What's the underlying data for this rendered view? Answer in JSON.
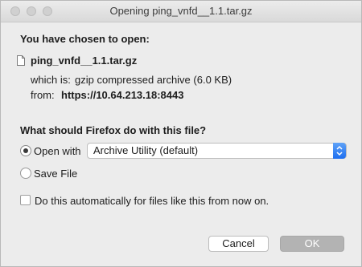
{
  "window": {
    "title": "Opening ping_vnfd__1.1.tar.gz"
  },
  "open": {
    "heading": "You have chosen to open:",
    "filename": "ping_vnfd__1.1.tar.gz",
    "which_is_label": "which is:",
    "which_is_value": "gzip compressed archive (6.0 KB)",
    "from_label": "from:",
    "from_value": "https://10.64.213.18:8443"
  },
  "action": {
    "heading": "What should Firefox do with this file?",
    "open_with_label": "Open with",
    "open_with_selected": "Archive Utility (default)",
    "save_file_label": "Save File",
    "selected_option": "open_with"
  },
  "auto": {
    "label": "Do this automatically for files like this from now on.",
    "checked": false
  },
  "buttons": {
    "cancel": "Cancel",
    "ok": "OK"
  }
}
